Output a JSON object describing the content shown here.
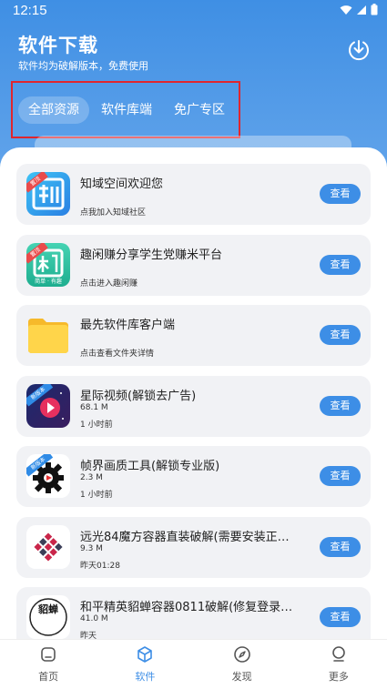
{
  "status_bar": {
    "time": "12:15"
  },
  "header": {
    "title": "软件下载",
    "subtitle": "软件均为破解版本，免费使用"
  },
  "tabs": [
    {
      "label": "全部资源",
      "active": true
    },
    {
      "label": "软件库端",
      "active": false
    },
    {
      "label": "免广专区",
      "active": false
    }
  ],
  "apps": [
    {
      "name": "知域空间欢迎您",
      "desc": "点我加入知域社区",
      "button": "查看",
      "badge": "置顶"
    },
    {
      "name": "趣闲赚分享学生党赚米平台",
      "desc": "点击进入趣闲赚",
      "button": "查看",
      "badge": "置顶",
      "icon_caption": "简单 · 有趣"
    },
    {
      "name": "最先软件库客户端",
      "desc": "点击查看文件夹详情",
      "button": "查看"
    },
    {
      "name": "星际视频(解锁去广告)",
      "size": "68.1 M",
      "time": "1 小时前",
      "button": "查看",
      "badge": "新版本"
    },
    {
      "name": "帧界画质工具(解锁专业版)",
      "size": "2.3 M",
      "time": "1 小时前",
      "button": "查看",
      "badge": "新版本"
    },
    {
      "name": "远光84魔方容器直装破解(需要安装正版游...",
      "size": "9.3 M",
      "time": "昨天01:28",
      "button": "查看"
    },
    {
      "name": "和平精英貂蝉容器0811破解(修复登录闪...",
      "size": "41.0 M",
      "time": "昨天",
      "button": "查看",
      "icon_text": "貂蝉"
    }
  ],
  "bottom_nav": [
    {
      "label": "首页",
      "icon": "home-icon",
      "active": false
    },
    {
      "label": "软件",
      "icon": "cube-icon",
      "active": true
    },
    {
      "label": "发现",
      "icon": "compass-icon",
      "active": false
    },
    {
      "label": "更多",
      "icon": "more-icon",
      "active": false
    }
  ],
  "colors": {
    "primary": "#3d8ee6",
    "highlight_border": "#e0262e"
  }
}
